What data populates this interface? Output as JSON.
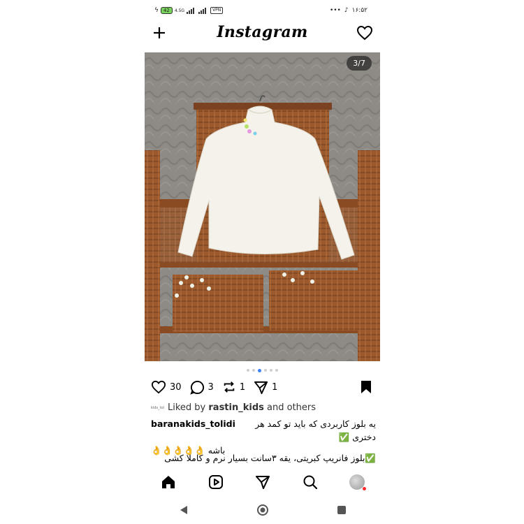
{
  "status_bar": {
    "left_icons": [
      "charging-icon",
      "battery-icon",
      "signal-icon",
      "vpn-icon"
    ],
    "battery_level": "42",
    "network": "4.5G",
    "vpn": "VPN",
    "time": "۱۶:۵۲",
    "more": "•••"
  },
  "header": {
    "logo": "Instagram",
    "left_icon": "plus-icon",
    "right_icon": "heart-icon"
  },
  "post": {
    "image_counter": "3/7",
    "carousel": {
      "total_dots": 6,
      "active_index": 2
    },
    "likes": "30",
    "comments": "3",
    "reposts": "1",
    "shares": "1",
    "liked_by_prefix": "Liked by ",
    "liked_by_user": "rastin_kids",
    "liked_by_suffix": " and others",
    "username": "baranakids_tolidi",
    "caption_line1": "یه بلوز کاربردی که باید تو کمد هر دختری ✅",
    "caption_line2": "باشه 👌👌👌👌👌",
    "caption_line3": "✅بلوز فانریپ کبریتی، یقه ۳سانت بسیار نرم و کاملا کشی"
  },
  "bottom_nav": {
    "items": [
      "home-icon",
      "reels-icon",
      "direct-icon",
      "search-icon",
      "profile-avatar"
    ]
  },
  "colors": {
    "accent": "#3b82f6",
    "badge": "#ff2b2b"
  }
}
